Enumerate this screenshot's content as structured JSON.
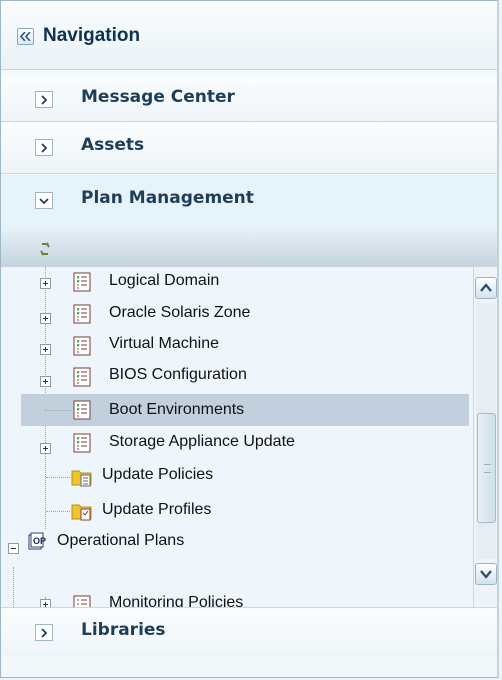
{
  "navigation": {
    "title": "Navigation"
  },
  "accordion": {
    "message_center": "Message Center",
    "assets": "Assets",
    "plan_management": "Plan Management",
    "libraries": "Libraries"
  },
  "tree": {
    "items": [
      {
        "label": "Logical Domain",
        "expander": "plus",
        "icon": "plan-template-icon"
      },
      {
        "label": "Oracle Solaris Zone",
        "expander": "plus",
        "icon": "plan-template-icon"
      },
      {
        "label": "Virtual Machine",
        "expander": "plus",
        "icon": "plan-template-icon"
      },
      {
        "label": "BIOS Configuration",
        "expander": "plus",
        "icon": "plan-template-icon"
      },
      {
        "label": "Boot Environments",
        "expander": "none",
        "icon": "plan-template-icon",
        "selected": true
      },
      {
        "label": "Storage Appliance Update",
        "expander": "plus",
        "icon": "plan-template-icon"
      },
      {
        "label": "Update Policies",
        "expander": "none",
        "icon": "policy-folder-icon"
      },
      {
        "label": "Update Profiles",
        "expander": "none",
        "icon": "profile-folder-icon"
      },
      {
        "label": "Operational Plans",
        "expander": "minus",
        "icon": "operational-plan-icon"
      },
      {
        "label": "Monitoring Policies",
        "expander": "plus",
        "icon": "plan-template-icon"
      }
    ]
  },
  "colors": {
    "selected_row": "#c2d0dd",
    "header_text": "#0d3352",
    "background": "#eef6fb"
  }
}
